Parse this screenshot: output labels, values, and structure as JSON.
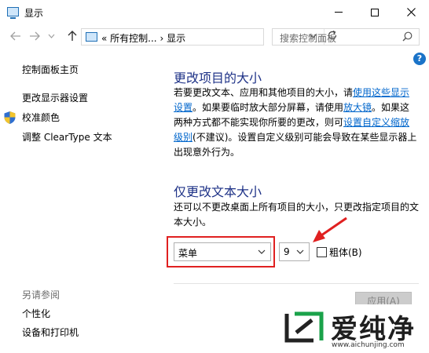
{
  "window": {
    "title": "显示"
  },
  "address_bar": {
    "path_prefix": "«",
    "path_parent": "所有控制...",
    "path_sep": "›",
    "path_current": "显示"
  },
  "search": {
    "placeholder": "搜索控制面板"
  },
  "sidebar": {
    "home": "控制面板主页",
    "items": [
      "更改显示器设置",
      "校准颜色",
      "调整 ClearType 文本"
    ],
    "see_also_heading": "另请参阅",
    "see_also": [
      "个性化",
      "设备和打印机"
    ]
  },
  "section1": {
    "title": "更改项目的大小",
    "text_1": "若要更改文本、应用和其他项目的大小，请",
    "link_1": "使用这些显示设置",
    "text_2": "。如果要临时放大部分屏幕，请使用",
    "link_2": "放大镜",
    "text_3": "。如果这两种方式都不能实现你所要的更改，则可",
    "link_3": "设置自定义缩放级别",
    "text_4": "(不建议)。设置自定义级别可能会导致在某些显示器上出现意外行为。"
  },
  "section2": {
    "title": "仅更改文本大小",
    "text": "还可以不更改桌面上所有项目的大小，只更改指定项目的文本大小。",
    "item_select_value": "菜单",
    "size_select_value": "9",
    "bold_label": "粗体(B)",
    "bold_checked": false
  },
  "apply_button": "应用(A)",
  "help_label": "?",
  "watermark": {
    "text": "爱纯净",
    "url": "www.aichunjing.com"
  },
  "colors": {
    "heading": "#1e3287",
    "link": "#0066cc",
    "highlight": "#e02020"
  }
}
